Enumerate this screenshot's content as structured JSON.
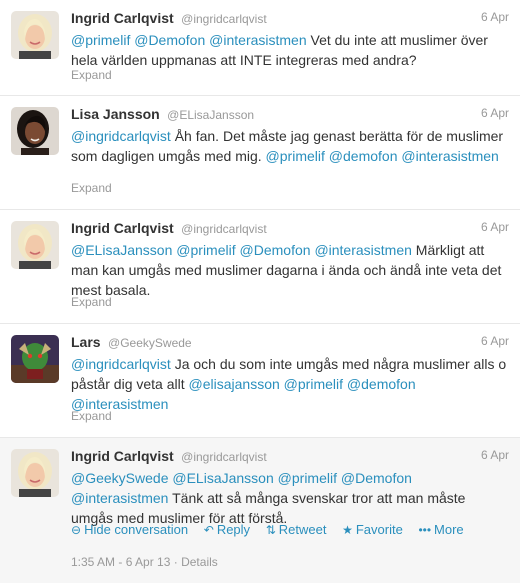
{
  "tweets": [
    {
      "fullname": "Ingrid Carlqvist",
      "username": "@ingridcarlqvist",
      "time": "6 Apr",
      "mentions": [
        "@primelif",
        "@Demofon",
        "@interasistmen"
      ],
      "text": "Vet du inte att muslimer över hela världen uppmanas att INTE integreras med andra?",
      "expand": "Expand"
    },
    {
      "fullname": "Lisa Jansson",
      "username": "@ELisaJansson",
      "time": "6 Apr",
      "lead_mention": "@ingridcarlqvist",
      "text": "Åh fan. Det måste jag genast berätta för de muslimer som dagligen umgås med mig.",
      "mentions": [
        "@primelif",
        "@demofon",
        "@interasistmen"
      ],
      "expand": "Expand"
    },
    {
      "fullname": "Ingrid Carlqvist",
      "username": "@ingridcarlqvist",
      "time": "6 Apr",
      "mentions": [
        "@ELisaJansson",
        "@primelif",
        "@Demofon",
        "@interasistmen"
      ],
      "text": "Märkligt att man kan umgås med muslimer dagarna i ända och ändå inte veta det mest basala.",
      "expand": "Expand"
    },
    {
      "fullname": "Lars",
      "username": "@GeekySwede",
      "time": "6 Apr",
      "lead_mention": "@ingridcarlqvist",
      "text": "Ja och du som inte umgås med några muslimer alls o påstår dig veta allt",
      "mentions": [
        "@elisajansson",
        "@primelif",
        "@demofon",
        "@interasistmen"
      ],
      "expand": "Expand"
    },
    {
      "fullname": "Ingrid Carlqvist",
      "username": "@ingridcarlqvist",
      "time": "6 Apr",
      "mentions": [
        "@GeekySwede",
        "@ELisaJansson",
        "@primelif",
        "@Demofon",
        "@interasistmen"
      ],
      "text": "Tänk att så många svenskar tror att man måste umgås med muslimer för att förstå.",
      "actions": {
        "hide": "Hide conversation",
        "reply": "Reply",
        "retweet": "Retweet",
        "favorite": "Favorite",
        "more": "More"
      },
      "timestamp": "1:35 AM - 6 Apr 13",
      "details": "Details"
    }
  ],
  "colors": {
    "link": "#2a8fbd",
    "muted": "#999999",
    "text": "#333333",
    "divider": "#e8e8e8"
  },
  "icons": {
    "hide": "minus-circle-icon",
    "reply": "reply-arrow-icon",
    "retweet": "retweet-icon",
    "favorite": "star-icon",
    "more": "ellipsis-icon"
  }
}
